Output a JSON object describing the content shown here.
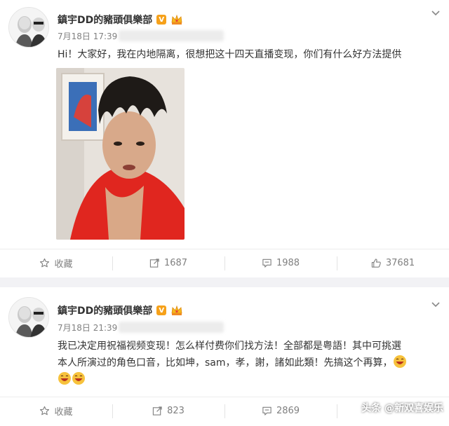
{
  "posts": [
    {
      "username": "鎮宇DD的豬頭俱樂部",
      "verified_badge": "V",
      "date": "7月18日 17:39",
      "text": "Hi！大家好，我在内地隔离，很想把这十四天直播变现，你们有什么好方法提供",
      "actions": {
        "favorite_label": "收藏",
        "repost_count": "1687",
        "comment_count": "1988",
        "like_count": "37681"
      }
    },
    {
      "username": "鎮宇DD的豬頭俱樂部",
      "verified_badge": "V",
      "date": "7月18日 21:39",
      "text_line1": "我已决定用祝福视频变现！怎么样付费你们找方法！全部都是粤語！其中可挑選",
      "text_line2": "本人所演过的角色口音，比如坤，sam，孝，謝，諸如此類！先搞这个再算，",
      "actions": {
        "favorite_label": "收藏",
        "repost_count": "823",
        "comment_count": "2869"
      }
    }
  ],
  "watermark": "头条 @新双喜娱乐",
  "colors": {
    "badge": "#f6a11a",
    "gap": "#f2f2f5",
    "muted": "#808080"
  },
  "icons": [
    "star-icon",
    "repost-icon",
    "comment-icon",
    "like-icon",
    "chevron-down-icon",
    "crown-icon",
    "laugh-emoji-icon"
  ]
}
